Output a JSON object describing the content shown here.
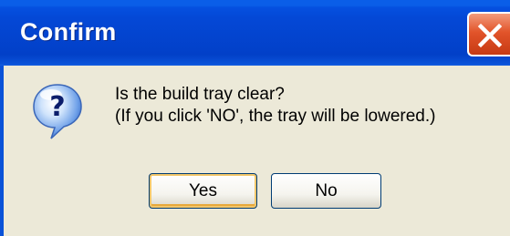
{
  "window": {
    "title": "Confirm",
    "close_icon": "close-icon"
  },
  "dialog": {
    "icon": "question-icon",
    "message_line1": "Is the build tray clear?",
    "message_line2": "(If you click 'NO', the tray will be lowered.)"
  },
  "buttons": {
    "yes_label": "Yes",
    "no_label": "No"
  },
  "colors": {
    "titlebar": "#0448d6",
    "body": "#ece9d8",
    "close_button": "#e2542a",
    "default_button_focus": "#f2c66a"
  }
}
